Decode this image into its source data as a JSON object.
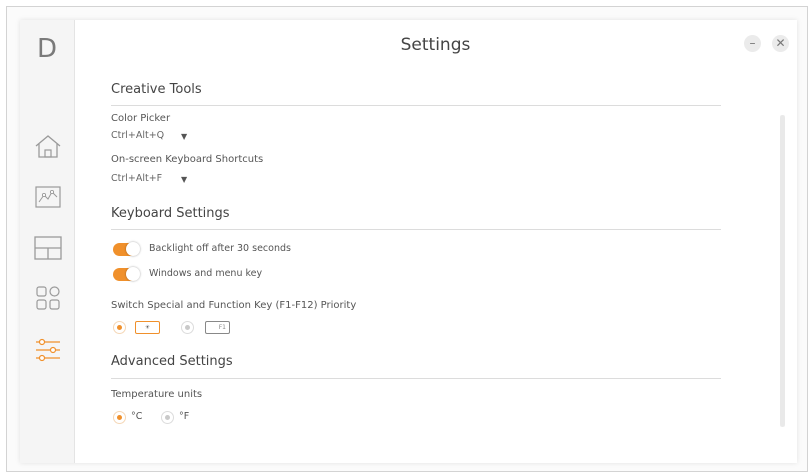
{
  "app": {
    "logo_letter": "D",
    "title": "Settings",
    "minimize_symbol": "–",
    "close_symbol": "✕"
  },
  "sidebar": {
    "items": [
      {
        "name": "home",
        "icon": "home-icon"
      },
      {
        "name": "display",
        "icon": "chart-icon"
      },
      {
        "name": "layout",
        "icon": "layout-icon"
      },
      {
        "name": "apps",
        "icon": "apps-grid-icon"
      },
      {
        "name": "settings",
        "icon": "sliders-icon",
        "active": true
      }
    ]
  },
  "sections": {
    "creative_tools": {
      "title": "Creative Tools",
      "color_picker": {
        "label": "Color Picker",
        "shortcut": "Ctrl+Alt+Q",
        "arrow": "▼"
      },
      "onscreen_keyboard": {
        "label": "On-screen Keyboard Shortcuts",
        "shortcut": "Ctrl+Alt+F",
        "arrow": "▼"
      }
    },
    "keyboard_settings": {
      "title": "Keyboard Settings",
      "backlight_toggle": {
        "label": "Backlight off after 30 seconds",
        "on": true
      },
      "windows_menu_toggle": {
        "label": "Windows and menu key",
        "on": true
      },
      "priority": {
        "label": "Switch Special and Function Key (F1-F12) Priority",
        "option_special_glyph": "☀",
        "option_fn_glyph": "F1",
        "selected": "special"
      }
    },
    "advanced_settings": {
      "title": "Advanced Settings",
      "temperature": {
        "label": "Temperature units",
        "celsius": "°C",
        "fahrenheit": "°F",
        "selected": "celsius"
      }
    }
  },
  "colors": {
    "accent": "#f0902b",
    "sidebar_bg": "#f5f5f5",
    "active_icon": "#f0902b",
    "icon": "#9a9a9a"
  }
}
